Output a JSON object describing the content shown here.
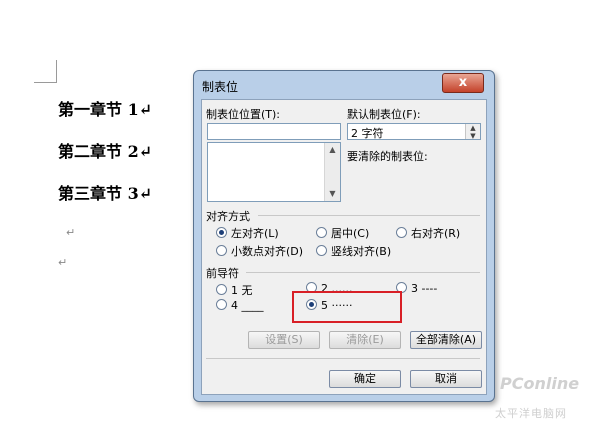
{
  "document": {
    "headings": [
      "第一章节 1↵",
      "第二章节 2↵",
      "第三章节 3↵"
    ],
    "para_marks": [
      "↵",
      "↵"
    ]
  },
  "dialog": {
    "title": "制表位",
    "close_label": "x",
    "tab_position_label": "制表位位置(T):",
    "tab_position_value": "",
    "default_tab_label": "默认制表位(F):",
    "default_tab_value": "2 字符",
    "to_clear_label": "要清除的制表位:",
    "alignment": {
      "title": "对齐方式",
      "options": [
        "左对齐(L)",
        "居中(C)",
        "右对齐(R)",
        "小数点对齐(D)",
        "竖线对齐(B)"
      ],
      "selected": "左对齐(L)"
    },
    "leader": {
      "title": "前导符",
      "options": [
        "1 无",
        "2 ......",
        "3 ----",
        "4 ____",
        "5 ······"
      ],
      "selected": "5 ······"
    },
    "buttons": {
      "set": "设置(S)",
      "clear": "清除(E)",
      "clear_all": "全部清除(A)",
      "ok": "确定",
      "cancel": "取消"
    }
  },
  "watermark": {
    "brand": "PConline",
    "subtitle": "太平洋电脑网"
  }
}
